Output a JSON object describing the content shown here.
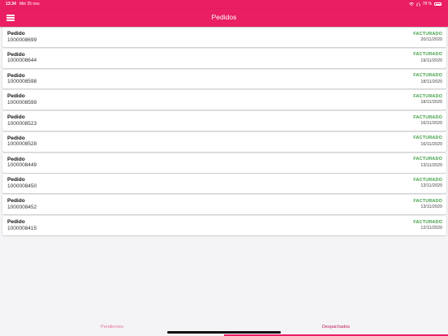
{
  "status_bar": {
    "time": "13:34",
    "date": "Mié 25 nov.",
    "battery": "78 %"
  },
  "app_bar": {
    "title": "Pedidos"
  },
  "orders": [
    {
      "label": "Pedido",
      "number": "1000008699",
      "status": "FACTURADO",
      "date": "20/11/2020"
    },
    {
      "label": "Pedido",
      "number": "1000008644",
      "status": "FACTURADO",
      "date": "19/11/2020"
    },
    {
      "label": "Pedido",
      "number": "1000008598",
      "status": "FACTURADO",
      "date": "18/11/2020"
    },
    {
      "label": "Pedido",
      "number": "1000008599",
      "status": "FACTURADO",
      "date": "18/11/2020"
    },
    {
      "label": "Pedido",
      "number": "1000008523",
      "status": "FACTURADO",
      "date": "16/11/2020"
    },
    {
      "label": "Pedido",
      "number": "1000008528",
      "status": "FACTURADO",
      "date": "16/11/2020"
    },
    {
      "label": "Pedido",
      "number": "1000008449",
      "status": "FACTURADO",
      "date": "13/11/2020"
    },
    {
      "label": "Pedido",
      "number": "1000008450",
      "status": "FACTURADO",
      "date": "13/11/2020"
    },
    {
      "label": "Pedido",
      "number": "1000008452",
      "status": "FACTURADO",
      "date": "13/11/2020"
    },
    {
      "label": "Pedido",
      "number": "1000008415",
      "status": "FACTURADO",
      "date": "12/11/2020"
    }
  ],
  "tabs": {
    "pending": "Pendientes",
    "dispatched": "Despachados",
    "active": "dispatched"
  },
  "colors": {
    "primary": "#e91e63",
    "status_green": "#43a047",
    "background": "#f4f4f6"
  },
  "icons": {
    "menu": "menu-icon",
    "wifi": "wifi-icon",
    "headphones": "headphones-icon",
    "battery": "battery-icon"
  }
}
